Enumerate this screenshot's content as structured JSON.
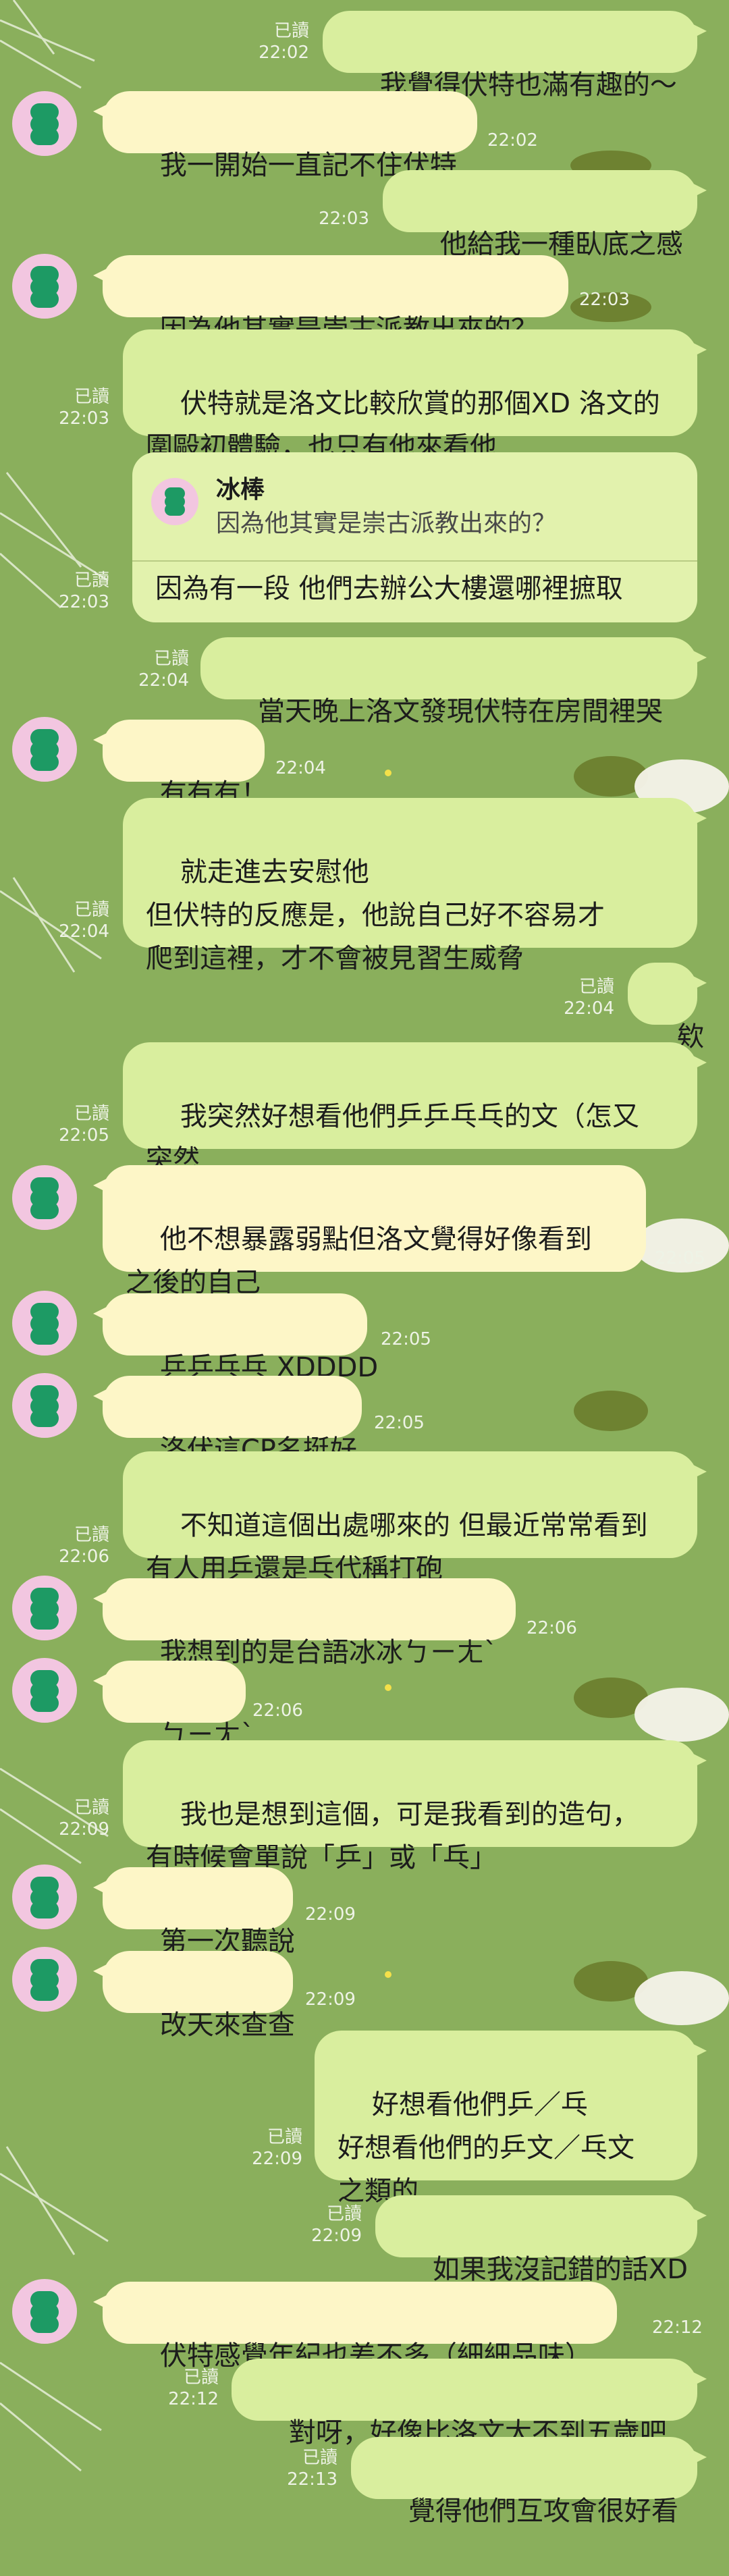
{
  "colors": {
    "background": "#8aaf5c",
    "outgoing_bubble": "#d9ee9e",
    "incoming_bubble": "#fdf6c7",
    "avatar_bg": "#f2c6e0",
    "avatar_icon": "#1d9a64"
  },
  "icons": {
    "avatar": "green-stacked-dango-icon",
    "background_art": "moomin-silhouette-decoration"
  },
  "messages": [
    {
      "id": "m1",
      "dir": "out",
      "text": "我覺得伏特也滿有趣的～",
      "read": "已讀",
      "time": "22:02"
    },
    {
      "id": "m2",
      "dir": "in",
      "text": "我一開始一直記不住伏特",
      "time": "22:02"
    },
    {
      "id": "m3",
      "dir": "out",
      "text": "他給我一種臥底之感",
      "read": "",
      "time": "22:03"
    },
    {
      "id": "m4",
      "dir": "in",
      "text": "因為他其實是崇古派教出來的？",
      "time": "22:03"
    },
    {
      "id": "m5",
      "dir": "out",
      "text": "伏特就是洛文比較欣賞的那個XD 洛文的\n圍毆初體驗，也只有他來看他",
      "read": "已讀",
      "time": "22:03"
    },
    {
      "id": "m6",
      "dir": "out",
      "reply": true,
      "quote_name": "冰棒",
      "quote_text": "因為他其實是崇古派教出來的？",
      "text": "因為有一段 他們去辦公大樓還哪裡摭取",
      "read": "已讀",
      "time": "22:03"
    },
    {
      "id": "m7",
      "dir": "out",
      "text": "當天晚上洛文發現伏特在房間裡哭",
      "read": "已讀",
      "time": "22:04"
    },
    {
      "id": "m8",
      "dir": "in",
      "text": "有有有！",
      "time": "22:04"
    },
    {
      "id": "m9",
      "dir": "out",
      "text": "就走進去安慰他\n但伏特的反應是，他說自己好不容易才\n爬到這裡，才不會被見習生威脅",
      "read": "已讀",
      "time": "22:04"
    },
    {
      "id": "m10",
      "dir": "out",
      "text": "欸",
      "read": "已讀",
      "time": "22:04"
    },
    {
      "id": "m11",
      "dir": "out",
      "text": "我突然好想看他們乒乒乓乓的文（怎又\n突然",
      "read": "已讀",
      "time": "22:05"
    },
    {
      "id": "m12",
      "dir": "in",
      "text": "他不想暴露弱點但洛文覺得好像看到\n之後的自己",
      "time": "22:05"
    },
    {
      "id": "m13",
      "dir": "in",
      "text": "乒乒乓乓 XDDDD",
      "time": "22:05"
    },
    {
      "id": "m14",
      "dir": "in",
      "text": "洛伏這CP名挺好",
      "time": "22:05"
    },
    {
      "id": "m15",
      "dir": "out",
      "text": "不知道這個出處哪來的 但最近常常看到\n有人用乒還是乓代稱打砲",
      "read": "已讀",
      "time": "22:06"
    },
    {
      "id": "m16",
      "dir": "in",
      "text": "我想到的是台語冰冰ㄅㄧㄤˋ",
      "time": "22:06"
    },
    {
      "id": "m17",
      "dir": "in",
      "text": "ㄅㄧㄤˋ",
      "time": "22:06"
    },
    {
      "id": "m18",
      "dir": "out",
      "text": "我也是想到這個，可是我看到的造句，\n有時候會單說「乒」或「乓」",
      "read": "已讀",
      "time": "22:09"
    },
    {
      "id": "m19",
      "dir": "in",
      "text": "第一次聽說",
      "time": "22:09"
    },
    {
      "id": "m20",
      "dir": "in",
      "text": "改天來查查",
      "time": "22:09"
    },
    {
      "id": "m21",
      "dir": "out",
      "text": "好想看他們乒／乓\n好想看他們的乒文／乓文\n之類的",
      "read": "已讀",
      "time": "22:09"
    },
    {
      "id": "m22",
      "dir": "out",
      "text": "如果我沒記錯的話XD",
      "read": "已讀",
      "time": "22:09"
    },
    {
      "id": "m23",
      "dir": "in",
      "text": "伏特感覺年紀也差不多（細細品味）",
      "time": "22:12"
    },
    {
      "id": "m24",
      "dir": "out",
      "text": "對呀，好像比洛文大不到五歲吧",
      "read": "已讀",
      "time": "22:12"
    },
    {
      "id": "m25",
      "dir": "out",
      "text": "覺得他們互攻會很好看",
      "read": "已讀",
      "time": "22:13"
    }
  ]
}
